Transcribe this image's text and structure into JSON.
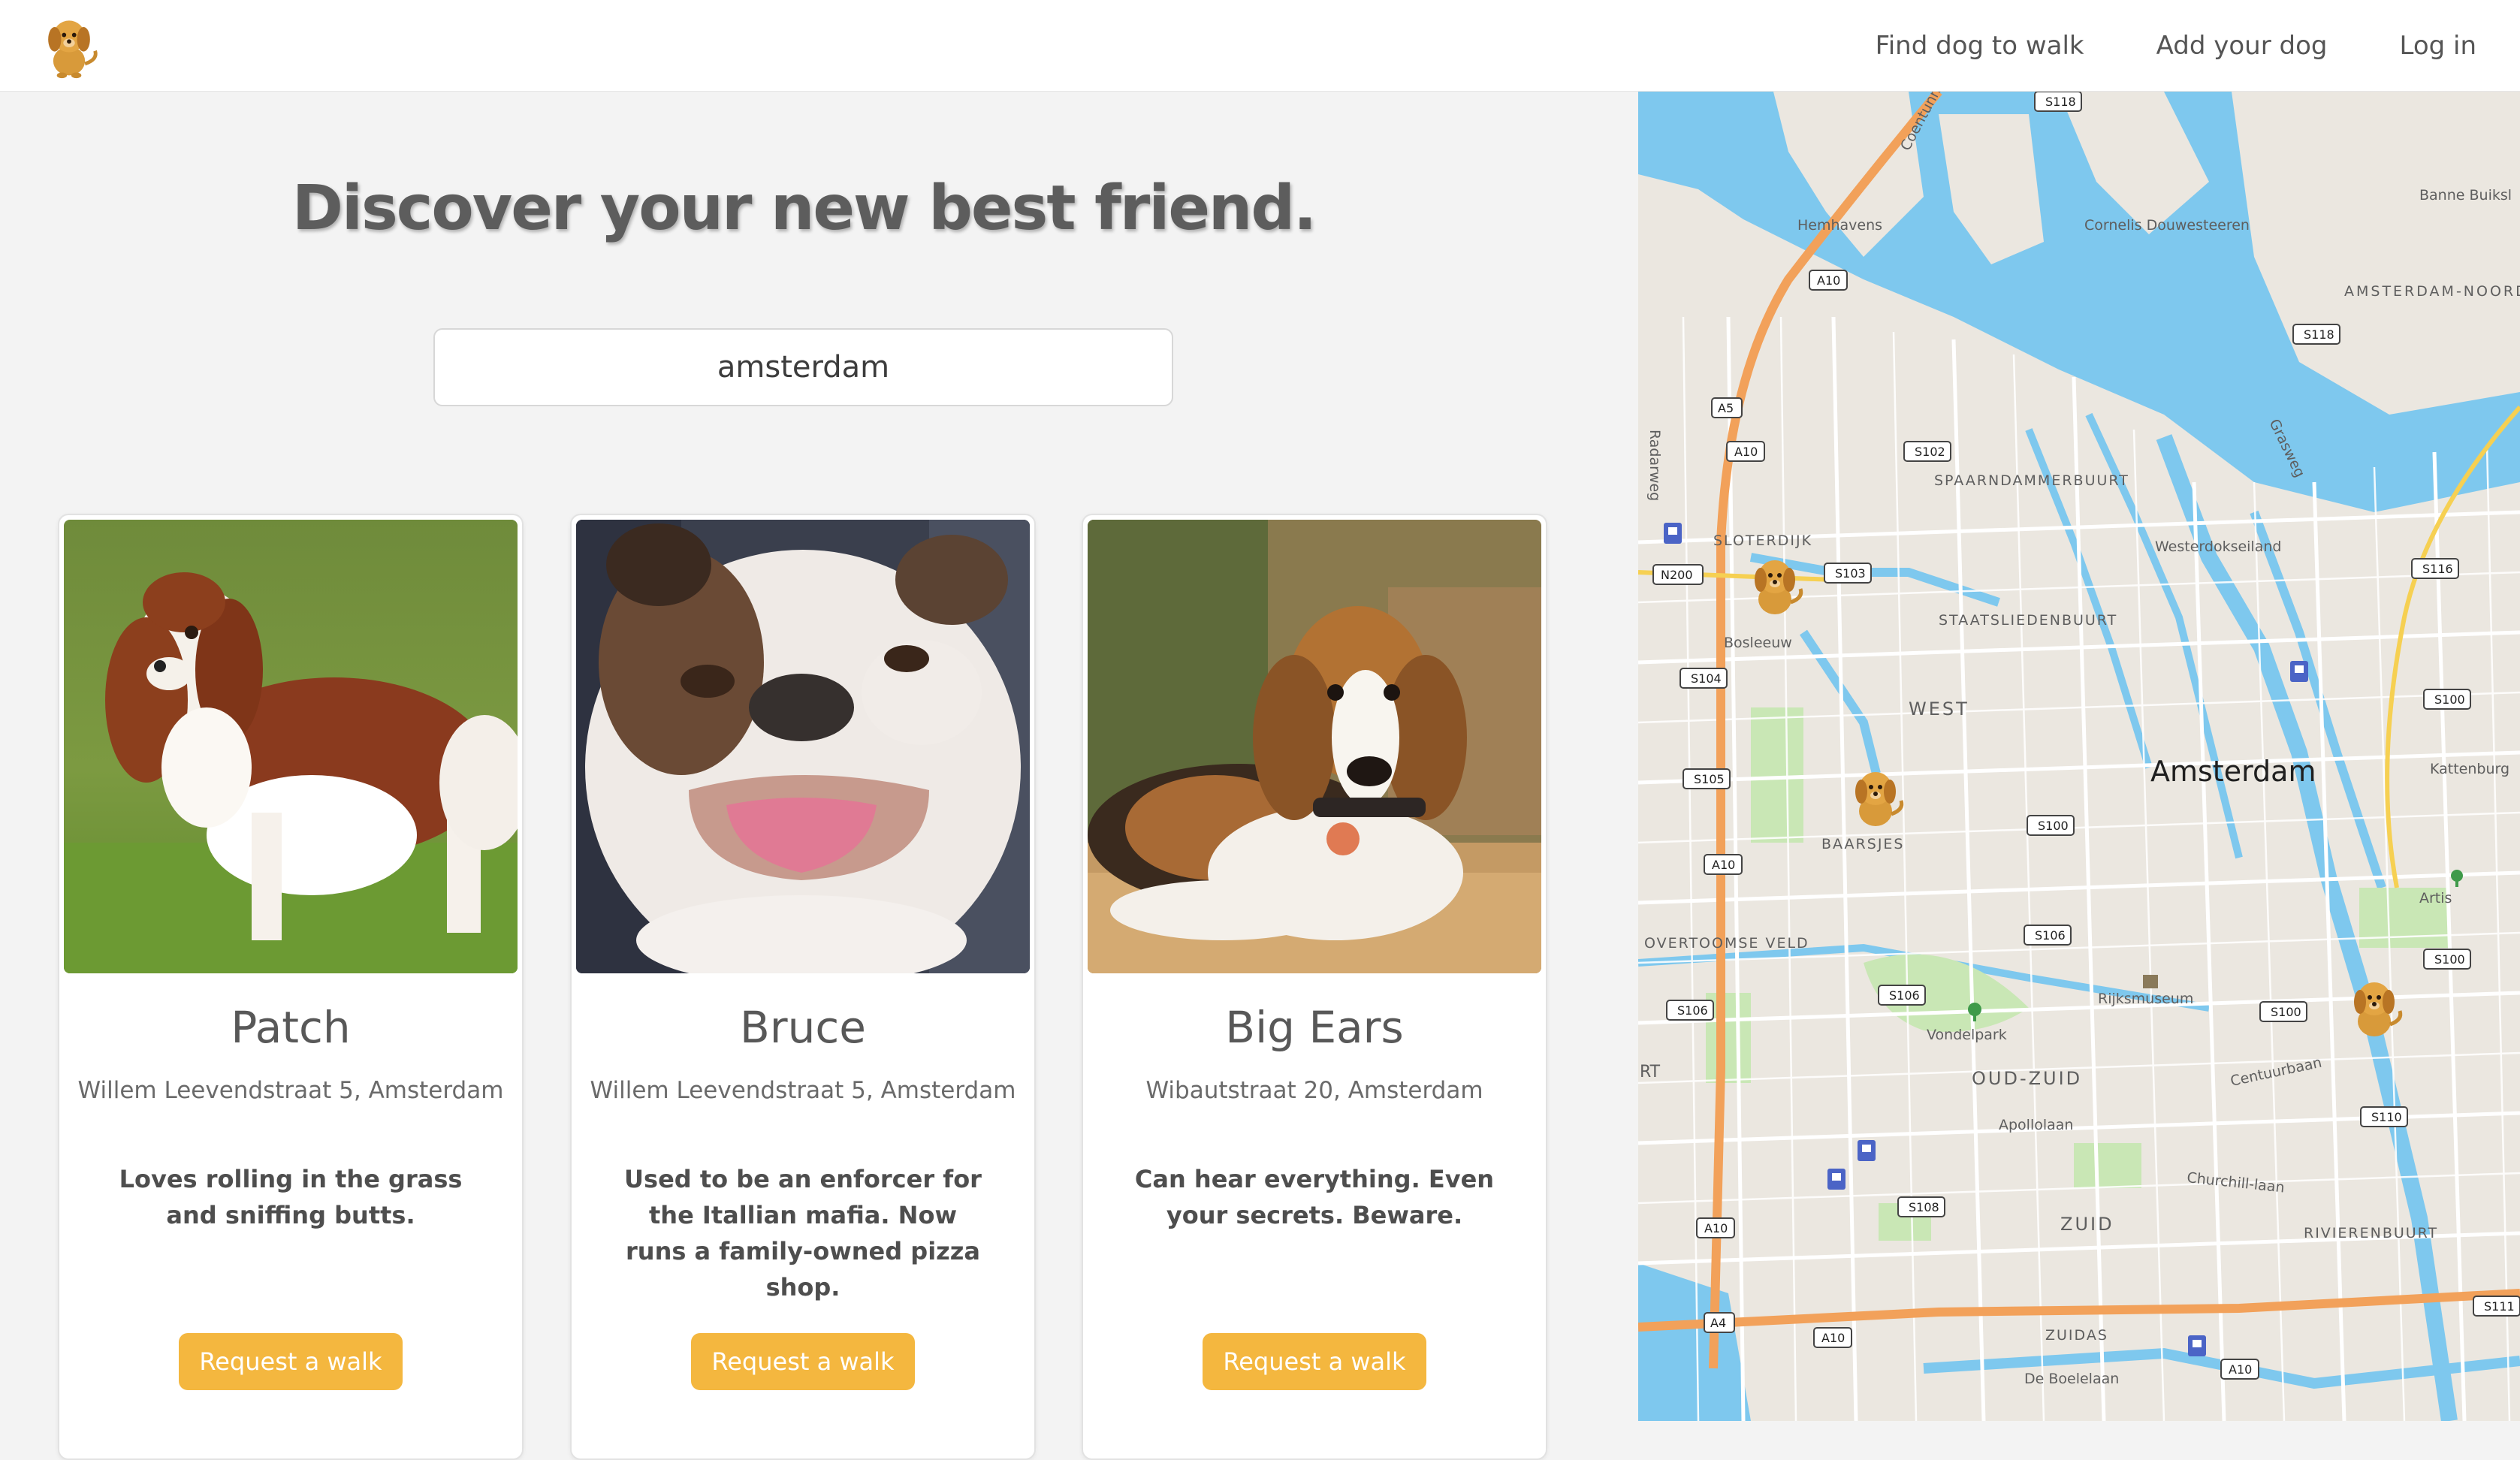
{
  "nav": {
    "logo_icon": "dog-logo-icon",
    "links": [
      {
        "label": "Find dog to walk"
      },
      {
        "label": "Add your dog"
      },
      {
        "label": "Log in"
      }
    ]
  },
  "hero": {
    "title": "Discover your new best friend."
  },
  "search": {
    "value": "amsterdam"
  },
  "cards": [
    {
      "name": "Patch",
      "address": "Willem Leevendstraat 5, Amsterdam",
      "bio": "Loves rolling in the grass and sniffing butts.",
      "button": "Request a walk",
      "photo_icon": "cavalier-dog-photo"
    },
    {
      "name": "Bruce",
      "address": "Willem Leevendstraat 5, Amsterdam",
      "bio": "Used to be an enforcer for the Itallian mafia. Now runs a family-owned pizza shop.",
      "button": "Request a walk",
      "photo_icon": "bulldog-photo"
    },
    {
      "name": "Big Ears",
      "address": "Wibautstraat 20, Amsterdam",
      "bio": "Can hear everything. Even your secrets. Beware.",
      "button": "Request a walk",
      "photo_icon": "beagle-photo"
    }
  ],
  "map": {
    "city": "Amsterdam",
    "marker_icon": "dog-marker-icon",
    "labels": [
      "Hemhavens",
      "Cornelis Douwesteeren",
      "Banne Buiksl",
      "AMSTERDAM-NOORD",
      "SPAARNDAMMERBUURT",
      "SLOTERDIJK",
      "Westerdokseiland",
      "STAATSLIEDENBUURT",
      "Bosleeuw",
      "WEST",
      "BAARSJES",
      "Kattenburg",
      "Artis",
      "OVERTOOMSE VELD",
      "Rijksmuseum",
      "Vondelpark",
      "OUD-ZUID",
      "Centuurbaan",
      "Apollolaan",
      "Churchill-laan",
      "RIVIERENBUURT",
      "ZUID",
      "ZUIDAS",
      "De Boelelaan",
      "Radarweg",
      "Coentunnel",
      "Grasweg",
      "RT"
    ],
    "road_badges": [
      "S118",
      "A10",
      "S118",
      "A5",
      "A10",
      "S102",
      "N200",
      "S103",
      "S116",
      "S104",
      "S100",
      "S105",
      "S100",
      "A10",
      "S106",
      "S106",
      "S106",
      "S100",
      "S100",
      "S110",
      "S108",
      "A10",
      "A4",
      "A10",
      "A10",
      "S111"
    ]
  },
  "colors": {
    "accent": "#f4b73f",
    "water": "#7ec8ee",
    "park": "#c9e7b5",
    "highway": "#f2a15a"
  }
}
